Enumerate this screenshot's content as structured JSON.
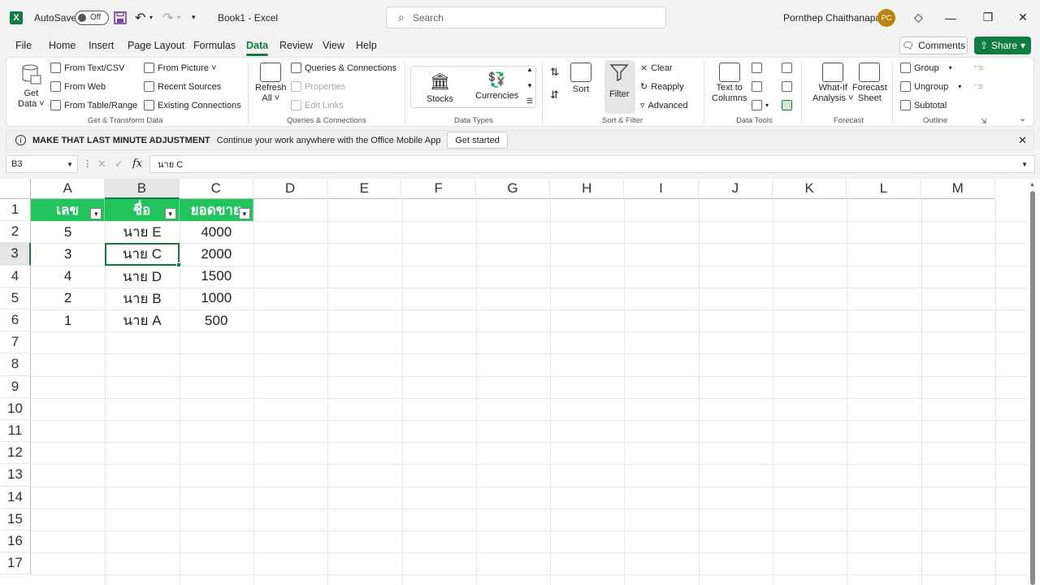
{
  "app": {
    "logo_letter": "X",
    "autosave_label": "AutoSave",
    "autosave_state": "Off",
    "doc_title": "Book1  -  Excel",
    "search_placeholder": "Search",
    "user_name": "Pornthep Chaithanapat",
    "user_initials": "PC"
  },
  "tabs": [
    {
      "label": "File"
    },
    {
      "label": "Home"
    },
    {
      "label": "Insert"
    },
    {
      "label": "Page Layout"
    },
    {
      "label": "Formulas"
    },
    {
      "label": "Data"
    },
    {
      "label": "Review"
    },
    {
      "label": "View"
    },
    {
      "label": "Help"
    }
  ],
  "tab_actions": {
    "comments": "Comments",
    "share": "Share"
  },
  "ribbon": {
    "get_transform": {
      "get_data_1": "Get",
      "get_data_2": "Data ˅",
      "from_text_csv": "From Text/CSV",
      "from_web": "From Web",
      "from_table_range": "From Table/Range",
      "from_picture": "From Picture ˅",
      "recent_sources": "Recent Sources",
      "existing_connections": "Existing Connections",
      "label": "Get & Transform Data"
    },
    "queries": {
      "refresh_1": "Refresh",
      "refresh_2": "All ˅",
      "queries_connections": "Queries & Connections",
      "properties": "Properties",
      "edit_links": "Edit Links",
      "label": "Queries & Connections"
    },
    "data_types": {
      "stocks": "Stocks",
      "currencies": "Currencies",
      "label": "Data Types"
    },
    "sort_filter": {
      "sort": "Sort",
      "filter": "Filter",
      "clear": "Clear",
      "reapply": "Reapply",
      "advanced": "Advanced",
      "label": "Sort & Filter"
    },
    "data_tools": {
      "text_to_1": "Text to",
      "text_to_2": "Columns",
      "label": "Data Tools"
    },
    "forecast": {
      "whatif_1": "What-If",
      "whatif_2": "Analysis ˅",
      "sheet_1": "Forecast",
      "sheet_2": "Sheet",
      "label": "Forecast"
    },
    "outline": {
      "group": "Group",
      "ungroup": "Ungroup",
      "subtotal": "Subtotal",
      "label": "Outline"
    }
  },
  "message_bar": {
    "title": "MAKE THAT LAST MINUTE ADJUSTMENT",
    "body": "Continue your work anywhere with the Office Mobile App",
    "button": "Get started"
  },
  "formula_bar": {
    "name_box": "B3",
    "fx": "fx",
    "content": "นาย C"
  },
  "grid": {
    "columns": [
      "A",
      "B",
      "C",
      "D",
      "E",
      "F",
      "G",
      "H",
      "I",
      "J",
      "K",
      "L",
      "M"
    ],
    "rows": [
      "1",
      "2",
      "3",
      "4",
      "5",
      "6",
      "7",
      "8",
      "9",
      "10",
      "11",
      "12",
      "13",
      "14",
      "15",
      "16",
      "17"
    ],
    "headers": [
      "เลข",
      "ชื่อ",
      "ยอดขาย"
    ],
    "data": [
      [
        "5",
        "นาย E",
        "4000"
      ],
      [
        "3",
        "นาย C",
        "2000"
      ],
      [
        "4",
        "นาย D",
        "1500"
      ],
      [
        "2",
        "นาย B",
        "1000"
      ],
      [
        "1",
        "นาย A",
        "500"
      ]
    ],
    "selected_cell": "B3",
    "header_color": "#22c45e",
    "accent_color": "#107c41"
  }
}
